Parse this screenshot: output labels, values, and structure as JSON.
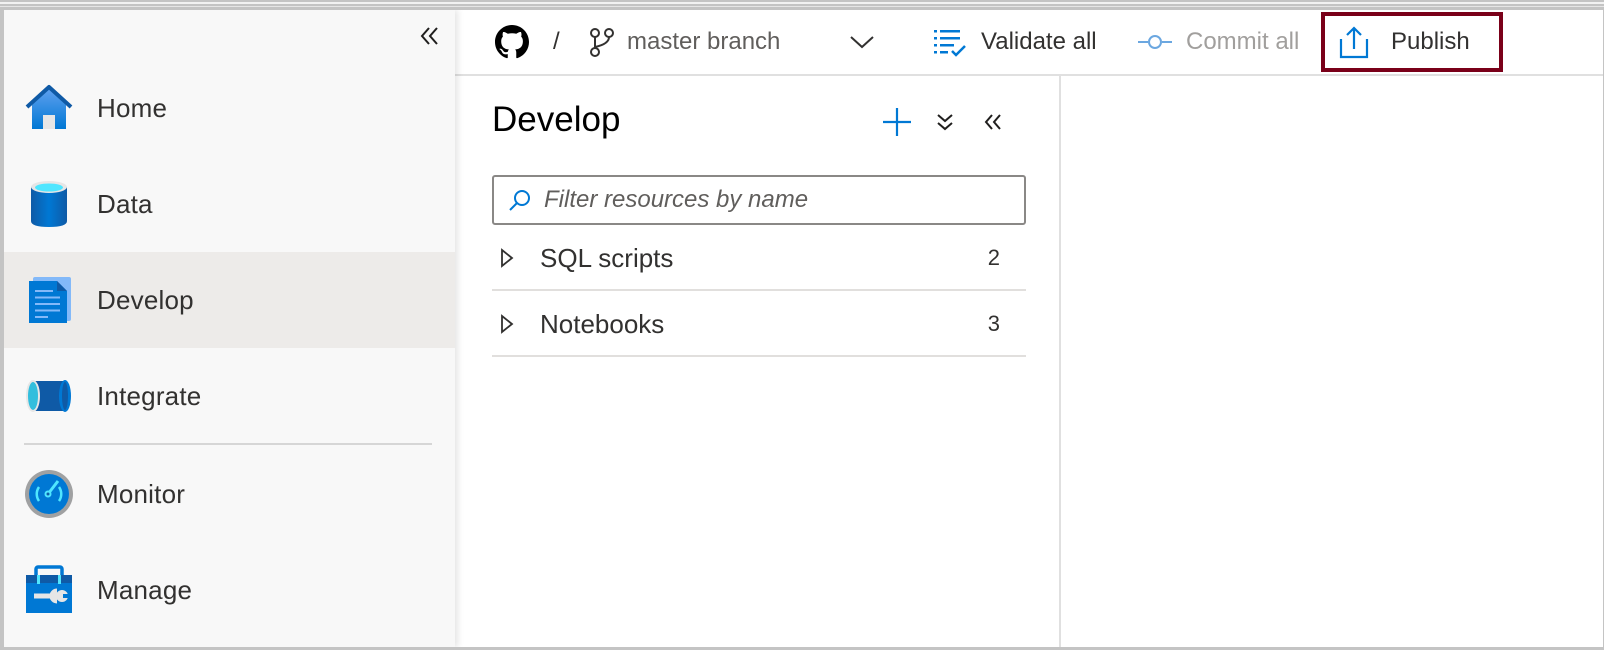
{
  "sidebar": {
    "collapse_label": "«",
    "items": [
      {
        "label": "Home",
        "icon": "home-icon",
        "selected": false
      },
      {
        "label": "Data",
        "icon": "database-icon",
        "selected": false
      },
      {
        "label": "Develop",
        "icon": "document-icon",
        "selected": true
      },
      {
        "label": "Integrate",
        "icon": "pipeline-icon",
        "selected": false
      },
      {
        "label": "Monitor",
        "icon": "gauge-icon",
        "selected": false
      },
      {
        "label": "Manage",
        "icon": "toolbox-icon",
        "selected": false
      }
    ]
  },
  "header": {
    "repo_icon": "github-icon",
    "separator": "/",
    "branch_icon": "branch-icon",
    "branch": "master branch",
    "validate_label": "Validate all",
    "commit_label": "Commit all",
    "publish_label": "Publish",
    "highlight_color": "#7a0019"
  },
  "panel": {
    "title": "Develop",
    "search_placeholder": "Filter resources by name",
    "search_value": "",
    "tree": [
      {
        "label": "SQL scripts",
        "count": "2"
      },
      {
        "label": "Notebooks",
        "count": "3"
      }
    ]
  },
  "colors": {
    "accent": "#0078d4",
    "selected_bg": "#edebe9",
    "sidebar_bg": "#f8f8f8"
  }
}
